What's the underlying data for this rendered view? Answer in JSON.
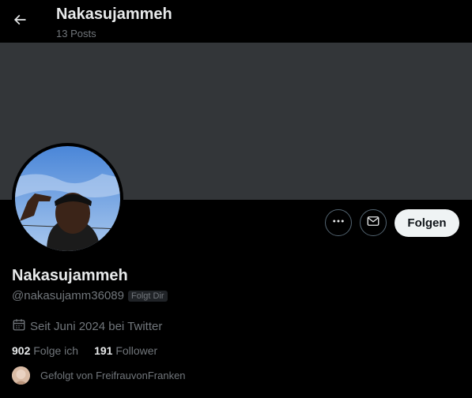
{
  "header": {
    "title": "Nakasujammeh",
    "posts_count": "13 Posts",
    "back_icon": "arrow-left-icon"
  },
  "profile": {
    "display_name": "Nakasujammeh",
    "handle": "@nakasujamm36089",
    "follows_you_badge": "Folgt Dir",
    "joined": "Seit Juni 2024 bei Twitter",
    "following_count": "902",
    "following_label": "Folge ich",
    "followers_count": "191",
    "followers_label": "Follower",
    "followed_by": "Gefolgt von FreifrauvonFranken"
  },
  "actions": {
    "more_icon": "more-horizontal-icon",
    "message_icon": "envelope-icon",
    "follow_label": "Folgen"
  },
  "colors": {
    "background": "#000000",
    "banner": "#333639",
    "muted_text": "#71767b",
    "primary_text": "#e7e9ea",
    "follow_button_bg": "#eff3f4"
  }
}
